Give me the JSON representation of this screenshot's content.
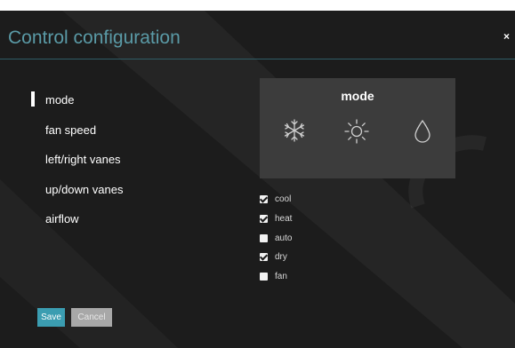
{
  "dialog": {
    "title": "Control configuration",
    "close_label": "×"
  },
  "nav": {
    "items": [
      {
        "label": "mode",
        "selected": true
      },
      {
        "label": "fan speed",
        "selected": false
      },
      {
        "label": "left/right vanes",
        "selected": false
      },
      {
        "label": "up/down vanes",
        "selected": false
      },
      {
        "label": "airflow",
        "selected": false
      }
    ]
  },
  "panel": {
    "title": "mode",
    "icons": [
      "snowflake-icon",
      "sun-icon",
      "droplet-icon"
    ]
  },
  "options": [
    {
      "label": "cool",
      "checked": true
    },
    {
      "label": "heat",
      "checked": true
    },
    {
      "label": "auto",
      "checked": false
    },
    {
      "label": "dry",
      "checked": true
    },
    {
      "label": "fan",
      "checked": false
    }
  ],
  "buttons": {
    "save_label": "Save",
    "cancel_label": "Cancel"
  },
  "colors": {
    "accent": "#3b9db1",
    "title": "#5a9aa6",
    "background": "#1c1c1c",
    "panel": "#3c3c3c"
  }
}
